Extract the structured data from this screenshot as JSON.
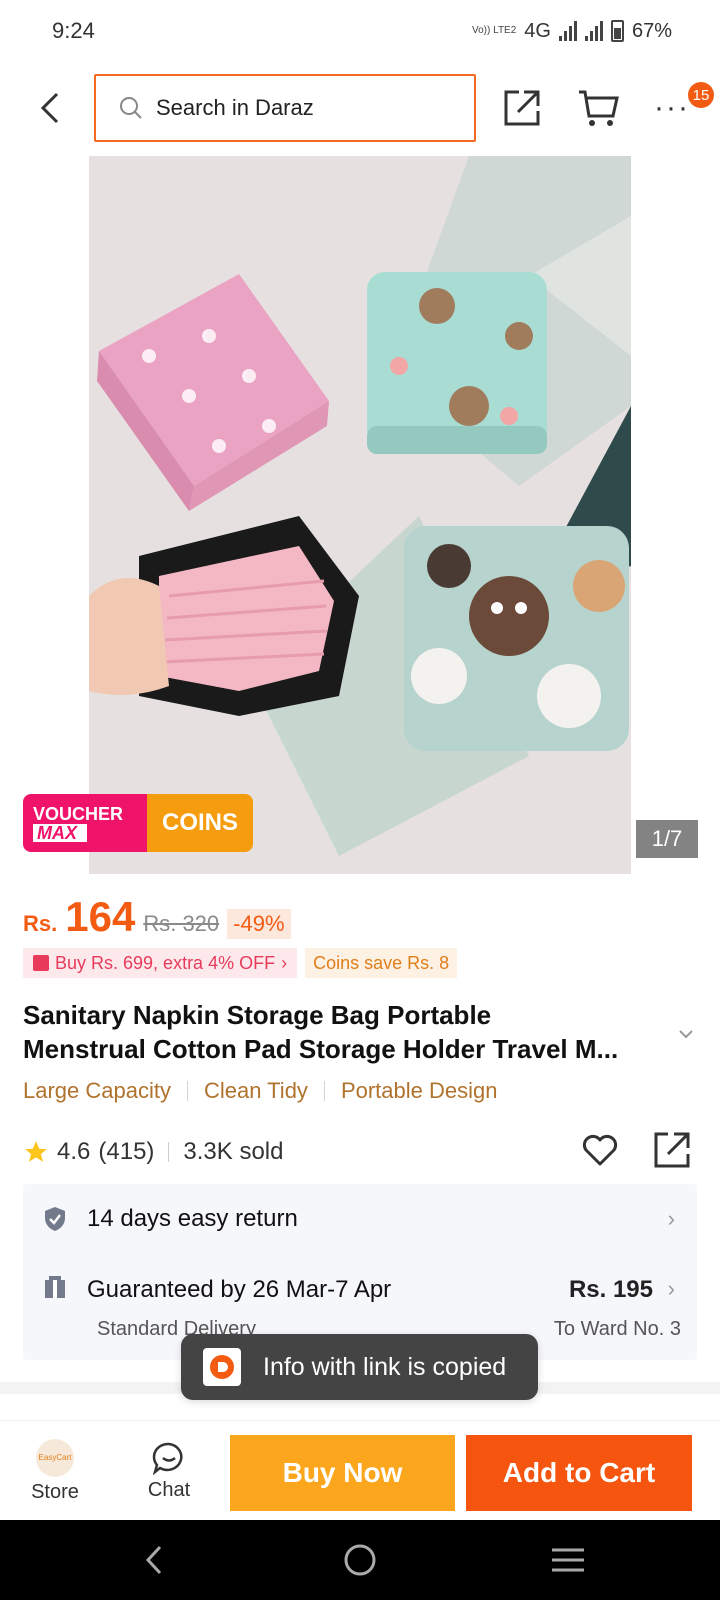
{
  "status_bar": {
    "time": "9:24",
    "network_badge": "Vo)) LTE2",
    "network_type": "4G",
    "battery": "67%"
  },
  "top_nav": {
    "search_placeholder": "Search in Daraz",
    "cart_badge": "15"
  },
  "product": {
    "image_counter": "1/7",
    "voucher_banner": {
      "line1": "VOUCHER",
      "line2": "MAX",
      "coins": "COINS"
    },
    "currency": "Rs.",
    "price": "164",
    "original_price": "Rs. 320",
    "discount": "-49%",
    "promo": "Buy Rs. 699, extra 4% OFF",
    "coins_save": "Coins save Rs. 8",
    "title_line1": "Sanitary Napkin Storage Bag Portable",
    "title_line2": "Menstrual Cotton Pad Storage Holder Travel M...",
    "tags": [
      "Large Capacity",
      "Clean Tidy",
      "Portable Design"
    ],
    "rating": "4.6",
    "rating_count": "(415)",
    "sold": "3.3K sold"
  },
  "service": {
    "return_text": "14 days easy return",
    "delivery_title": "Guaranteed by 26 Mar-7 Apr",
    "delivery_price": "Rs. 195",
    "delivery_type": "Standard Delivery",
    "delivery_to": "To Ward No. 3"
  },
  "toast": {
    "text": "Info with link is copied"
  },
  "bottom_bar": {
    "store": "Store",
    "store_logo_text": "EasyCart",
    "chat": "Chat",
    "buy_now": "Buy Now",
    "add_to_cart": "Add to Cart"
  },
  "colors": {
    "accent": "#f35b13",
    "buy_now": "#fca61d",
    "add_to_cart": "#f5550e",
    "search_border": "#f26b21",
    "tag": "#b0732e"
  },
  "icons": [
    "back-arrow-icon",
    "search-icon",
    "share-icon",
    "cart-icon",
    "more-icon",
    "star-icon",
    "heart-icon",
    "shield-check-icon",
    "delivery-box-icon",
    "chevron-right-icon",
    "chat-icon",
    "daraz-icon"
  ]
}
